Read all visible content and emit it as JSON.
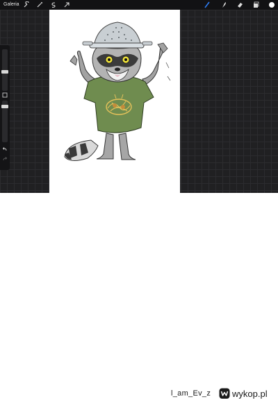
{
  "toolbar": {
    "gallery_label": "Galeria",
    "left_icons": [
      "wrench-icon",
      "magic-wand-icon",
      "selection-s-icon",
      "transform-arrow-icon"
    ],
    "right_icons": [
      "brush-icon",
      "smudge-icon",
      "eraser-icon",
      "layers-icon",
      "color-swatch-icon"
    ],
    "active_color": "#ffffff",
    "brush_highlight": "#2d7ef7"
  },
  "sidebar": {
    "icons": [
      "size-slider",
      "modify-button",
      "opacity-slider",
      "undo-icon",
      "redo-icon"
    ]
  },
  "footer": {
    "username": "l_am_Ev_z",
    "brand": "wykop.pl"
  }
}
